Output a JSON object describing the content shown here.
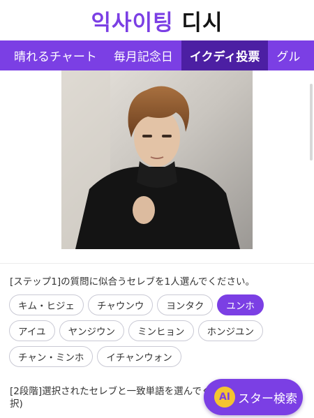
{
  "header": {
    "logo_part_a": "익사이팅",
    "logo_part_b": "디시"
  },
  "nav": {
    "items": [
      {
        "label": "晴れるチャート"
      },
      {
        "label": "毎月記念日"
      },
      {
        "label": "イクディ投票"
      },
      {
        "label": "グル"
      }
    ],
    "active_index": 2
  },
  "photo": {
    "icon": "celebrity-photo"
  },
  "step1": {
    "prompt": "[ステップ1]の質問に似合うセレブを1人選んでください。",
    "options": [
      {
        "label": "キム・ヒジェ"
      },
      {
        "label": "チャウンウ"
      },
      {
        "label": "ヨンタク"
      },
      {
        "label": "ユンホ"
      },
      {
        "label": "アイユ"
      },
      {
        "label": "ヤンジウン"
      },
      {
        "label": "ミンヒョン"
      },
      {
        "label": "ホンジユン"
      },
      {
        "label": "チャン・ミンホ"
      },
      {
        "label": "イチャンウォン"
      }
    ],
    "selected": "ユンホ"
  },
  "step2": {
    "prompt": "[2段階]選択されたセレブと一致単語を選んでください。(最大3つ選択)"
  },
  "ai_search": {
    "icon_text": "AI",
    "label": "スター検索"
  },
  "colors": {
    "accent": "#7b3fe4",
    "nav_active": "#4c1fa3",
    "ai_badge": "#f4c431"
  }
}
